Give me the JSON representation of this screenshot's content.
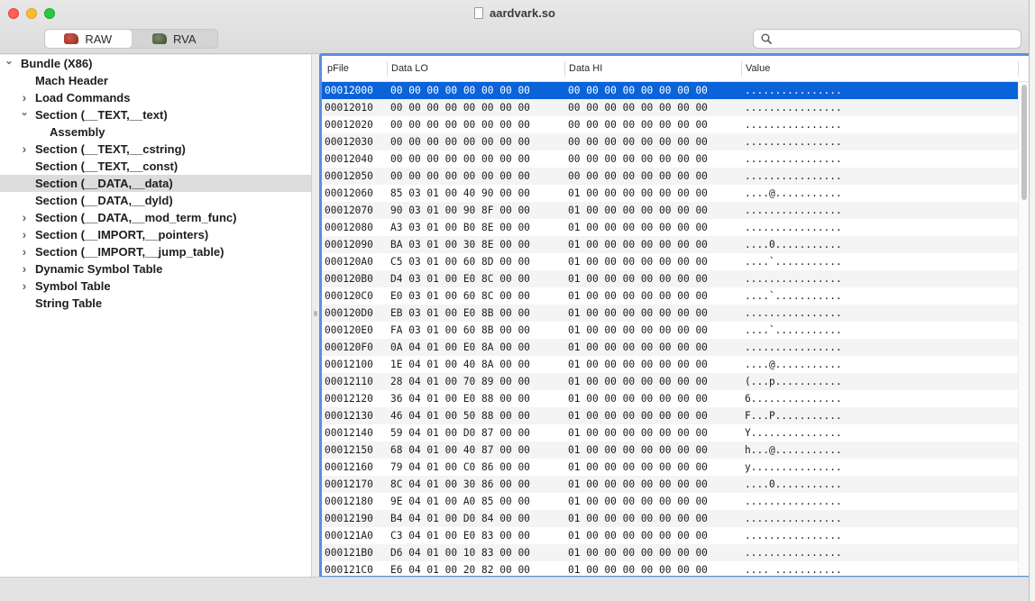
{
  "window": {
    "title": "aardvark.so"
  },
  "toolbar": {
    "mode_tabs": [
      {
        "label": "RAW",
        "icon": "raw-mode-icon",
        "active": true
      },
      {
        "label": "RVA",
        "icon": "rva-mode-icon",
        "active": false
      }
    ],
    "search": {
      "value": "",
      "placeholder": ""
    }
  },
  "sidebar": {
    "items": [
      {
        "label": "Bundle (X86)",
        "level": 0,
        "disclosure": "expanded",
        "selected": false
      },
      {
        "label": "Mach Header",
        "level": 1,
        "disclosure": "none",
        "selected": false
      },
      {
        "label": "Load Commands",
        "level": 1,
        "disclosure": "collapsed",
        "selected": false
      },
      {
        "label": "Section (__TEXT,__text)",
        "level": 1,
        "disclosure": "expanded",
        "selected": false
      },
      {
        "label": "Assembly",
        "level": 2,
        "disclosure": "none",
        "selected": false
      },
      {
        "label": "Section (__TEXT,__cstring)",
        "level": 1,
        "disclosure": "collapsed",
        "selected": false
      },
      {
        "label": "Section (__TEXT,__const)",
        "level": 1,
        "disclosure": "none",
        "selected": false
      },
      {
        "label": "Section (__DATA,__data)",
        "level": 1,
        "disclosure": "none",
        "selected": true
      },
      {
        "label": "Section (__DATA,__dyld)",
        "level": 1,
        "disclosure": "none",
        "selected": false
      },
      {
        "label": "Section (__DATA,__mod_term_func)",
        "level": 1,
        "disclosure": "collapsed",
        "selected": false
      },
      {
        "label": "Section (__IMPORT,__pointers)",
        "level": 1,
        "disclosure": "collapsed",
        "selected": false
      },
      {
        "label": "Section (__IMPORT,__jump_table)",
        "level": 1,
        "disclosure": "collapsed",
        "selected": false
      },
      {
        "label": "Dynamic Symbol Table",
        "level": 1,
        "disclosure": "collapsed",
        "selected": false
      },
      {
        "label": "Symbol Table",
        "level": 1,
        "disclosure": "collapsed",
        "selected": false
      },
      {
        "label": "String Table",
        "level": 1,
        "disclosure": "none",
        "selected": false
      }
    ]
  },
  "hex_table": {
    "columns": {
      "offset": "pFile",
      "lo": "Data LO",
      "hi": "Data HI",
      "value": "Value"
    },
    "selected_row": 0,
    "rows": [
      {
        "offset": "00012000",
        "lo": "00 00 00 00 00 00 00 00",
        "hi": "00 00 00 00 00 00 00 00",
        "value": "................"
      },
      {
        "offset": "00012010",
        "lo": "00 00 00 00 00 00 00 00",
        "hi": "00 00 00 00 00 00 00 00",
        "value": "................"
      },
      {
        "offset": "00012020",
        "lo": "00 00 00 00 00 00 00 00",
        "hi": "00 00 00 00 00 00 00 00",
        "value": "................"
      },
      {
        "offset": "00012030",
        "lo": "00 00 00 00 00 00 00 00",
        "hi": "00 00 00 00 00 00 00 00",
        "value": "................"
      },
      {
        "offset": "00012040",
        "lo": "00 00 00 00 00 00 00 00",
        "hi": "00 00 00 00 00 00 00 00",
        "value": "................"
      },
      {
        "offset": "00012050",
        "lo": "00 00 00 00 00 00 00 00",
        "hi": "00 00 00 00 00 00 00 00",
        "value": "................"
      },
      {
        "offset": "00012060",
        "lo": "85 03 01 00 40 90 00 00",
        "hi": "01 00 00 00 00 00 00 00",
        "value": "....@..........."
      },
      {
        "offset": "00012070",
        "lo": "90 03 01 00 90 8F 00 00",
        "hi": "01 00 00 00 00 00 00 00",
        "value": "................"
      },
      {
        "offset": "00012080",
        "lo": "A3 03 01 00 B0 8E 00 00",
        "hi": "01 00 00 00 00 00 00 00",
        "value": "................"
      },
      {
        "offset": "00012090",
        "lo": "BA 03 01 00 30 8E 00 00",
        "hi": "01 00 00 00 00 00 00 00",
        "value": "....0..........."
      },
      {
        "offset": "000120A0",
        "lo": "C5 03 01 00 60 8D 00 00",
        "hi": "01 00 00 00 00 00 00 00",
        "value": "....`..........."
      },
      {
        "offset": "000120B0",
        "lo": "D4 03 01 00 E0 8C 00 00",
        "hi": "01 00 00 00 00 00 00 00",
        "value": "................"
      },
      {
        "offset": "000120C0",
        "lo": "E0 03 01 00 60 8C 00 00",
        "hi": "01 00 00 00 00 00 00 00",
        "value": "....`..........."
      },
      {
        "offset": "000120D0",
        "lo": "EB 03 01 00 E0 8B 00 00",
        "hi": "01 00 00 00 00 00 00 00",
        "value": "................"
      },
      {
        "offset": "000120E0",
        "lo": "FA 03 01 00 60 8B 00 00",
        "hi": "01 00 00 00 00 00 00 00",
        "value": "....`..........."
      },
      {
        "offset": "000120F0",
        "lo": "0A 04 01 00 E0 8A 00 00",
        "hi": "01 00 00 00 00 00 00 00",
        "value": "................"
      },
      {
        "offset": "00012100",
        "lo": "1E 04 01 00 40 8A 00 00",
        "hi": "01 00 00 00 00 00 00 00",
        "value": "....@..........."
      },
      {
        "offset": "00012110",
        "lo": "28 04 01 00 70 89 00 00",
        "hi": "01 00 00 00 00 00 00 00",
        "value": "(...p..........."
      },
      {
        "offset": "00012120",
        "lo": "36 04 01 00 E0 88 00 00",
        "hi": "01 00 00 00 00 00 00 00",
        "value": "6..............."
      },
      {
        "offset": "00012130",
        "lo": "46 04 01 00 50 88 00 00",
        "hi": "01 00 00 00 00 00 00 00",
        "value": "F...P..........."
      },
      {
        "offset": "00012140",
        "lo": "59 04 01 00 D0 87 00 00",
        "hi": "01 00 00 00 00 00 00 00",
        "value": "Y..............."
      },
      {
        "offset": "00012150",
        "lo": "68 04 01 00 40 87 00 00",
        "hi": "01 00 00 00 00 00 00 00",
        "value": "h...@..........."
      },
      {
        "offset": "00012160",
        "lo": "79 04 01 00 C0 86 00 00",
        "hi": "01 00 00 00 00 00 00 00",
        "value": "y..............."
      },
      {
        "offset": "00012170",
        "lo": "8C 04 01 00 30 86 00 00",
        "hi": "01 00 00 00 00 00 00 00",
        "value": "....0..........."
      },
      {
        "offset": "00012180",
        "lo": "9E 04 01 00 A0 85 00 00",
        "hi": "01 00 00 00 00 00 00 00",
        "value": "................"
      },
      {
        "offset": "00012190",
        "lo": "B4 04 01 00 D0 84 00 00",
        "hi": "01 00 00 00 00 00 00 00",
        "value": "................"
      },
      {
        "offset": "000121A0",
        "lo": "C3 04 01 00 E0 83 00 00",
        "hi": "01 00 00 00 00 00 00 00",
        "value": "................"
      },
      {
        "offset": "000121B0",
        "lo": "D6 04 01 00 10 83 00 00",
        "hi": "01 00 00 00 00 00 00 00",
        "value": "................"
      },
      {
        "offset": "000121C0",
        "lo": "E6 04 01 00 20 82 00 00",
        "hi": "01 00 00 00 00 00 00 00",
        "value": ".... ..........."
      }
    ]
  },
  "colors": {
    "selection": "#0a63d8",
    "focus_ring": "#5a8ee0",
    "sidebar_selected": "#dcdcdc",
    "row_alternate": "#f4f4f4"
  }
}
